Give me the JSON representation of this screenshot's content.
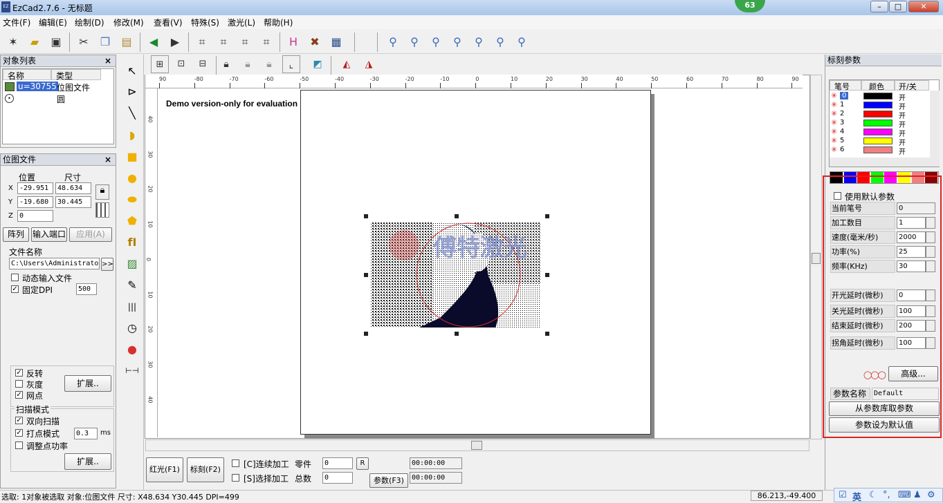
{
  "window": {
    "title": "EzCad2.7.6 - 无标题",
    "badge": "63"
  },
  "menu": [
    "文件(F)",
    "编辑(E)",
    "绘制(D)",
    "修改(M)",
    "查看(V)",
    "特殊(S)",
    "激光(L)",
    "帮助(H)"
  ],
  "object_list": {
    "title": "对象列表",
    "col_name": "名称",
    "col_type": "类型",
    "rows": [
      {
        "name": "u=30755",
        "type": "位图文件"
      },
      {
        "name": "",
        "type": "圆"
      }
    ]
  },
  "bitmap_panel": {
    "title": "位图文件",
    "pos_label": "位置",
    "size_label": "尺寸",
    "x_label": "X",
    "y_label": "Y",
    "z_label": "Z",
    "x_pos": "-29.951",
    "x_size": "48.634",
    "y_pos": "-19.680",
    "y_size": "30.445",
    "z_pos": "0",
    "btn_array": "阵列",
    "btn_input": "输入端口",
    "btn_apply": "应用(A)",
    "file_label": "文件名称",
    "file_path": "C:\\Users\\Administrato",
    "browse": ">>",
    "dynamic": "动态输入文件",
    "fixed_dpi": "固定DPI",
    "dpi": "500",
    "invert": "反转",
    "gray": "灰度",
    "dither": "网点",
    "expand1": "扩展..",
    "scan_mode": "扫描模式",
    "bidir": "双向扫描",
    "dot_mode": "打点模式",
    "dot_val": "0.3",
    "dot_unit": "ms",
    "adjust_power": "调整点功率",
    "expand2": "扩展.."
  },
  "canvas": {
    "watermark": "Demo version-only for evaluation",
    "ruler_h": [
      "90",
      "-80",
      "-70",
      "-60",
      "-50",
      "-40",
      "-30",
      "-20",
      "-10",
      "0",
      "10",
      "20",
      "30",
      "40",
      "50",
      "60",
      "70",
      "80",
      "90"
    ],
    "ruler_v": [
      "40",
      "30",
      "20",
      "10",
      "0",
      "10",
      "20",
      "30",
      "40"
    ]
  },
  "bottom": {
    "red_btn": "红光(F1)",
    "mark_btn": "标刻(F2)",
    "continuous": "[C]连续加工",
    "select_proc": "[S]选择加工",
    "parts_label": "零件",
    "parts_val": "0",
    "total_label": "总数",
    "total_val": "0",
    "r_btn": "R",
    "param_btn": "参数(F3)",
    "time1": "00:00:00",
    "time2": "00:00:00"
  },
  "mark_params": {
    "title": "标刻参数",
    "pen_col": "笔号",
    "color_col": "颜色",
    "onoff_col": "开/关",
    "pens": [
      {
        "no": "0",
        "color": "#000000",
        "state": "开"
      },
      {
        "no": "1",
        "color": "#0000ff",
        "state": "开"
      },
      {
        "no": "2",
        "color": "#ff0000",
        "state": "开"
      },
      {
        "no": "3",
        "color": "#00ff00",
        "state": "开"
      },
      {
        "no": "4",
        "color": "#ff00ff",
        "state": "开"
      },
      {
        "no": "5",
        "color": "#ffff00",
        "state": "开"
      },
      {
        "no": "6",
        "color": "#f08080",
        "state": "开"
      }
    ],
    "palette": [
      "#000000",
      "#0000ff",
      "#ff0000",
      "#00ff00",
      "#ff00ff",
      "#ffff00",
      "#f08080",
      "#8b0000"
    ],
    "use_default": "使用默认参数",
    "current_pen_label": "当前笔号",
    "current_pen": "0",
    "count_label": "加工数目",
    "count": "1",
    "speed_label": "速度(毫米/秒)",
    "speed": "2000",
    "power_label": "功率(%)",
    "power": "25",
    "freq_label": "频率(KHz)",
    "freq": "30",
    "on_delay_label": "开光延时(微秒)",
    "on_delay": "0",
    "off_delay_label": "关光延时(微秒)",
    "off_delay": "100",
    "end_delay_label": "结束延时(微秒)",
    "end_delay": "200",
    "corner_delay_label": "拐角延时(微秒)",
    "corner_delay": "100",
    "advanced": "高级...",
    "param_name_label": "参数名称",
    "param_name": "Default",
    "from_lib": "从参数库取参数",
    "set_default": "参数设为默认值"
  },
  "status": {
    "left": "选取: 1对象被选取 对象:位图文件 尺寸: X48.634 Y30.445 DPI=499",
    "coords": "86.213,-49.400",
    "ime": "英"
  }
}
